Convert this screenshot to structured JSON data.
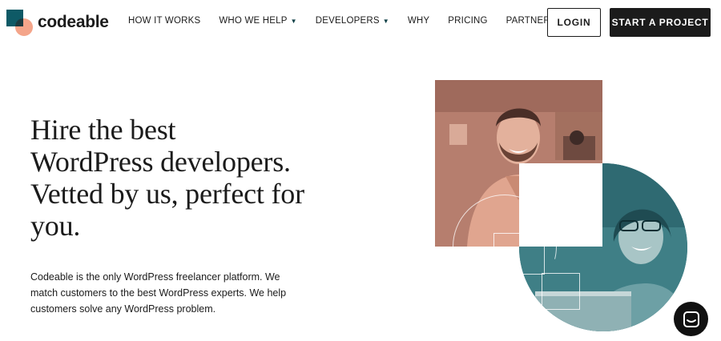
{
  "header": {
    "logo_text": "codeable",
    "nav": [
      {
        "label": "HOW IT WORKS",
        "has_dropdown": false
      },
      {
        "label": "WHO WE HELP",
        "has_dropdown": true
      },
      {
        "label": "DEVELOPERS",
        "has_dropdown": true
      },
      {
        "label": "WHY",
        "has_dropdown": false
      },
      {
        "label": "PRICING",
        "has_dropdown": false
      },
      {
        "label": "PARTNERS",
        "has_dropdown": true
      }
    ],
    "login_label": "LOGIN",
    "cta_label": "START A PROJECT"
  },
  "hero": {
    "headline_lines": [
      "Hire the best",
      "WordPress developers.",
      "Vetted by us, perfect for",
      "you."
    ],
    "subtext": "Codeable is the only WordPress freelancer platform. We match customers to the best WordPress experts. We help customers solve any WordPress problem."
  },
  "colors": {
    "brand_teal": "#0e5a66",
    "brand_peach": "#f4a58a",
    "photo_salmon": "#b67e6e",
    "photo_teal": "#3f7f86",
    "cta_bg": "#1b1b1b"
  },
  "icons": {
    "chat": "chat-bubble-icon",
    "dropdown": "caret-down-icon"
  }
}
